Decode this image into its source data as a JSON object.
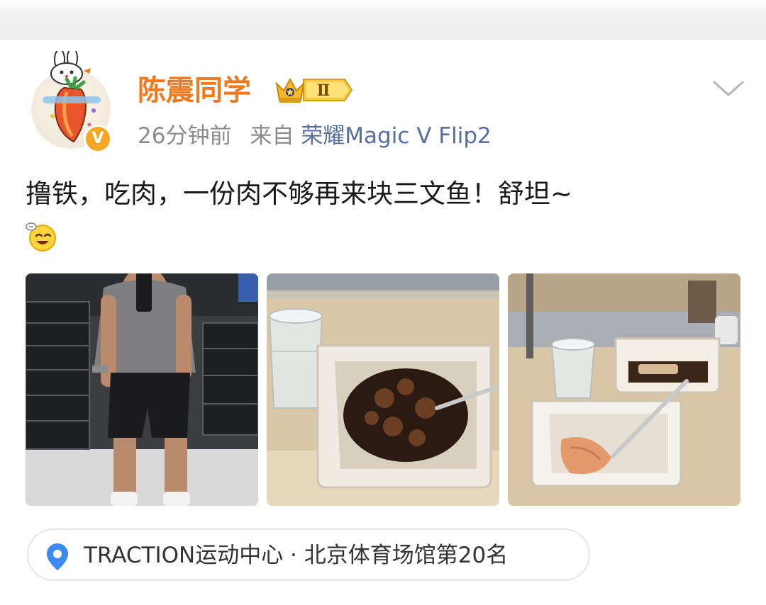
{
  "post": {
    "username": "陈震同学",
    "badge_level": "Ⅱ",
    "time": "26分钟前",
    "source_prefix": "来自",
    "device": "荣耀Magic V Flip2",
    "text": "撸铁，吃肉，一份肉不够再来块三文鱼！舒坦~",
    "emoji": "smiling-face-emoji",
    "verified_mark": "V"
  },
  "photos": [
    {
      "alt": "gym mirror selfie"
    },
    {
      "alt": "bowl of braised meat with water glass"
    },
    {
      "alt": "salmon and tray with fork"
    }
  ],
  "location": {
    "icon": "location-pin-icon",
    "text": "TRACTION运动中心 · 北京体育场馆第20名"
  },
  "colors": {
    "username": "#f07a1d",
    "device_link": "#566f9e",
    "meta": "#8b8b8b",
    "pin": "#3d8bf0"
  }
}
